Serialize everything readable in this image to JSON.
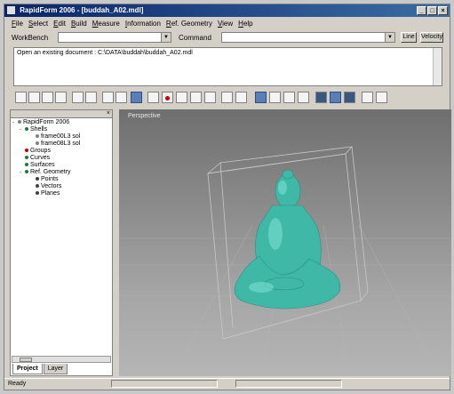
{
  "window": {
    "title": "RapidForm 2006 - [buddah_A02.mdl]",
    "title_buttons": [
      "_",
      "□",
      "×"
    ]
  },
  "menu": [
    "File",
    "Select",
    "Edit",
    "Build",
    "Measure",
    "Information",
    "Ref. Geometry",
    "View",
    "Help"
  ],
  "command_bar": {
    "workbench_label": "WorkBench",
    "command_label": "Command",
    "line_button": "Line",
    "extra_button": "Velocity"
  },
  "output": {
    "message": "Open an existing document : C:\\DATA\\buddah\\buddah_A02.mdl"
  },
  "project_tree": {
    "items": [
      {
        "label": "RapidForm 2006",
        "color": "#808080",
        "expander": "-"
      },
      {
        "label": "Shells",
        "color": "#1a7a3a",
        "expander": "-"
      },
      {
        "label": "frame00L3 sol",
        "color": "#808080",
        "expander": ""
      },
      {
        "label": "frame08L3 sol",
        "color": "#808080",
        "expander": ""
      },
      {
        "label": "Groups",
        "color": "#c00000",
        "expander": ""
      },
      {
        "label": "Curves",
        "color": "#1a7a3a",
        "expander": ""
      },
      {
        "label": "Surfaces",
        "color": "#1a7a3a",
        "expander": ""
      },
      {
        "label": "Ref. Geometry",
        "color": "#1a7a3a",
        "expander": "-"
      },
      {
        "label": "Points",
        "color": "#404040",
        "expander": ""
      },
      {
        "label": "Vectors",
        "color": "#404040",
        "expander": ""
      },
      {
        "label": "Planes",
        "color": "#404040",
        "expander": ""
      }
    ]
  },
  "panel_tabs": [
    "Project",
    "Layer"
  ],
  "viewport": {
    "label": "Perspective",
    "model_color": "#3fb8a8"
  },
  "statusbar": {
    "text": "Ready"
  }
}
